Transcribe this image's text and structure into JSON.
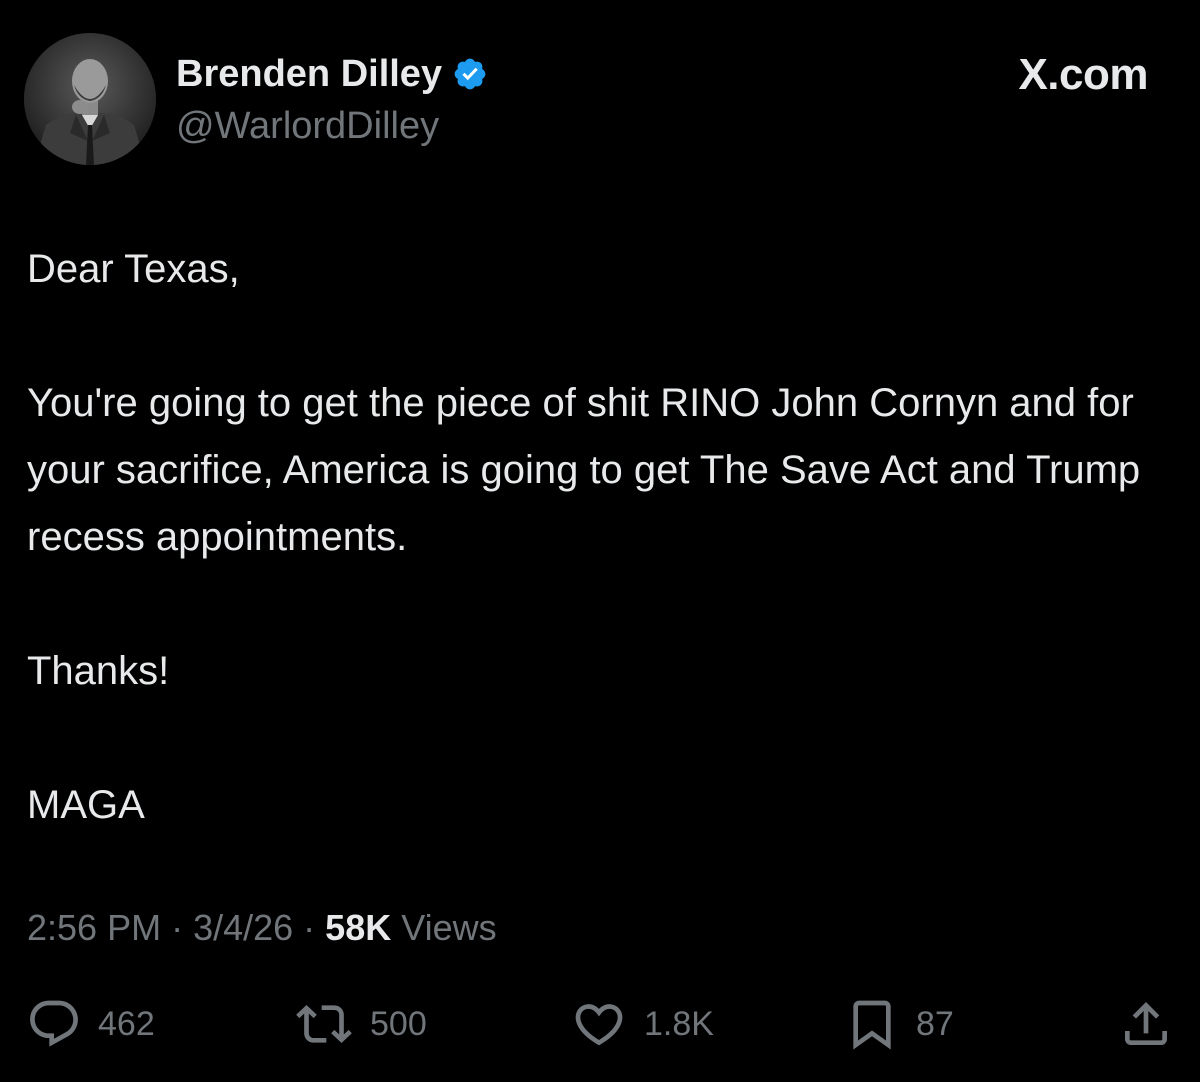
{
  "author": {
    "display_name": "Brenden Dilley",
    "handle": "@WarlordDilley",
    "verified_icon": "verified-badge-icon",
    "verified_color": "#1d9bf0"
  },
  "brand": {
    "label": "X.com"
  },
  "tweet": {
    "paragraphs": [
      "Dear Texas,",
      "You're going to get the piece of shit RINO John Cornyn and for your sacrifice, America is going to get The Save Act and Trump recess appointments.",
      "Thanks!",
      "MAGA"
    ]
  },
  "meta": {
    "time": "2:56 PM",
    "separator": " · ",
    "date": "3/4/26",
    "views_count": "58K",
    "views_label": "Views"
  },
  "actions": {
    "replies": {
      "icon": "reply-icon",
      "count": "462"
    },
    "reposts": {
      "icon": "repost-icon",
      "count": "500"
    },
    "likes": {
      "icon": "heart-icon",
      "count": "1.8K"
    },
    "bookmarks": {
      "icon": "bookmark-icon",
      "count": "87"
    },
    "share": {
      "icon": "share-icon"
    }
  },
  "colors": {
    "background": "#000000",
    "text_primary": "#e7e9ea",
    "text_secondary": "#71767b"
  }
}
